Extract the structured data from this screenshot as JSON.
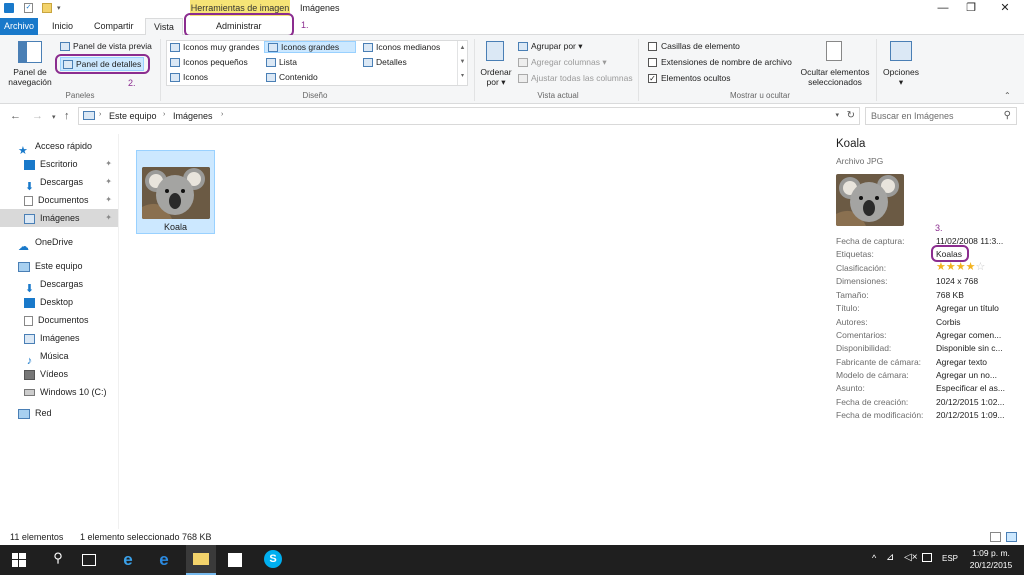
{
  "titlebar": {
    "context_tab": "Herramientas de imagen",
    "window_title": "Imágenes",
    "controls": {
      "minimize": "—",
      "maximize": "❐",
      "close": "✕"
    }
  },
  "tabs": [
    {
      "label": "Archivo"
    },
    {
      "label": "Inicio"
    },
    {
      "label": "Compartir"
    },
    {
      "label": "Vista"
    },
    {
      "label": "Administrar"
    }
  ],
  "ribbon": {
    "panes": {
      "nav_pane": "Panel de navegación",
      "preview_pane": "Panel de vista previa",
      "details_pane": "Panel de detalles",
      "group_label": "Paneles"
    },
    "layout": {
      "items": [
        "Iconos muy grandes",
        "Iconos grandes",
        "Iconos medianos",
        "Iconos pequeños",
        "Lista",
        "Detalles",
        "Iconos",
        "Contenido"
      ],
      "selected": "Iconos grandes",
      "group_label": "Diseño"
    },
    "current_view": {
      "sort_by": "Ordenar por",
      "group_by": "Agrupar por",
      "add_columns": "Agregar columnas",
      "fit_columns": "Ajustar todas las columnas",
      "group_label": "Vista actual"
    },
    "show_hide": {
      "item_checkboxes": "Casillas de elemento",
      "file_extensions": "Extensiones de nombre de archivo",
      "hidden_items": "Elementos ocultos",
      "hide_selected": "Ocultar elementos seleccionados",
      "group_label": "Mostrar u ocultar"
    },
    "options": "Opciones"
  },
  "address": {
    "path": [
      "Este equipo",
      "Imágenes"
    ],
    "search_placeholder": "Buscar en Imágenes"
  },
  "nav": {
    "quick_access": "Acceso rápido",
    "quick_items": [
      "Escritorio",
      "Descargas",
      "Documentos",
      "Imágenes"
    ],
    "onedrive": "OneDrive",
    "this_pc": "Este equipo",
    "pc_items": [
      "Descargas",
      "Desktop",
      "Documentos",
      "Imágenes",
      "Música",
      "Vídeos",
      "Windows 10 (C:)"
    ],
    "network": "Red"
  },
  "files": [
    {
      "name": "Koala"
    }
  ],
  "details": {
    "title": "Koala",
    "type": "Archivo JPG",
    "props": [
      {
        "label": "Fecha de captura:",
        "value": "11/02/2008 11:3..."
      },
      {
        "label": "Etiquetas:",
        "value": "Koalas"
      },
      {
        "label": "Clasificación:",
        "value": ""
      },
      {
        "label": "Dimensiones:",
        "value": "1024 x 768"
      },
      {
        "label": "Tamaño:",
        "value": "768 KB"
      },
      {
        "label": "Título:",
        "value": "Agregar un título"
      },
      {
        "label": "Autores:",
        "value": "Corbis"
      },
      {
        "label": "Comentarios:",
        "value": "Agregar comen..."
      },
      {
        "label": "Disponibilidad:",
        "value": "Disponible sin c..."
      },
      {
        "label": "Fabricante de cámara:",
        "value": "Agregar texto"
      },
      {
        "label": "Modelo de cámara:",
        "value": "Agregar un no..."
      },
      {
        "label": "Asunto:",
        "value": "Especificar el as..."
      },
      {
        "label": "Fecha de creación:",
        "value": "20/12/2015 1:02..."
      },
      {
        "label": "Fecha de modificación:",
        "value": "20/12/2015 1:09..."
      }
    ],
    "rating": 4,
    "rating_max": 5
  },
  "status": {
    "count": "11 elementos",
    "selection": "1 elemento seleccionado",
    "size": "768 KB"
  },
  "taskbar": {
    "lang": "ESP",
    "time": "1:09 p. m.",
    "date": "20/12/2015"
  },
  "annotations": {
    "n1": "1.",
    "n2": "2.",
    "n3": "3."
  },
  "colors": {
    "file_tab": "#1979ca",
    "context_tab": "#f6e476",
    "selection": "#cce8ff",
    "annotation": "#8b2d8f",
    "taskbar": "#1f1f1f"
  }
}
